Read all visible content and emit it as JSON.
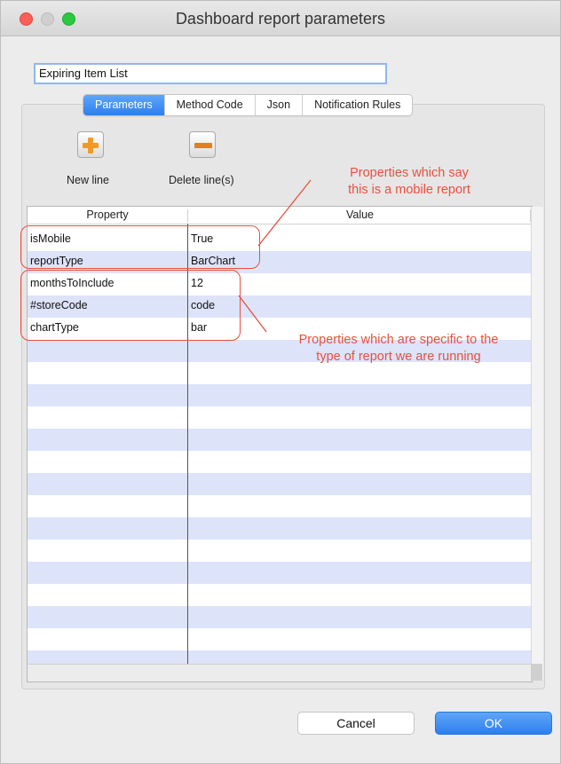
{
  "window": {
    "title": "Dashboard report parameters"
  },
  "report_name": {
    "value": "Expiring Item List"
  },
  "tabs": [
    {
      "label": "Parameters",
      "active": true
    },
    {
      "label": "Method Code",
      "active": false
    },
    {
      "label": "Json",
      "active": false
    },
    {
      "label": "Notification Rules",
      "active": false
    }
  ],
  "toolbar": {
    "new_line_label": "New line",
    "delete_lines_label": "Delete line(s)",
    "new_line_icon": "plus-icon",
    "delete_icon": "minus-icon",
    "icon_color": "#f19a2a"
  },
  "table": {
    "headers": [
      "Property",
      "Value"
    ],
    "rows": [
      {
        "property": "isMobile",
        "value": "True"
      },
      {
        "property": "reportType",
        "value": "BarChart"
      },
      {
        "property": "monthsToInclude",
        "value": "12"
      },
      {
        "property": "#storeCode",
        "value": "code"
      },
      {
        "property": "chartType",
        "value": "bar"
      }
    ],
    "alt_row_color": "#dde3f9"
  },
  "annotations": {
    "mobile_line1": "Properties which say",
    "mobile_line2": "this is a mobile report",
    "specific_line1": "Properties which are specific to the",
    "specific_line2": "type of report we are running",
    "color": "#e8513f"
  },
  "buttons": {
    "cancel": "Cancel",
    "ok": "OK"
  },
  "colors": {
    "accent": "#2d7fee"
  }
}
